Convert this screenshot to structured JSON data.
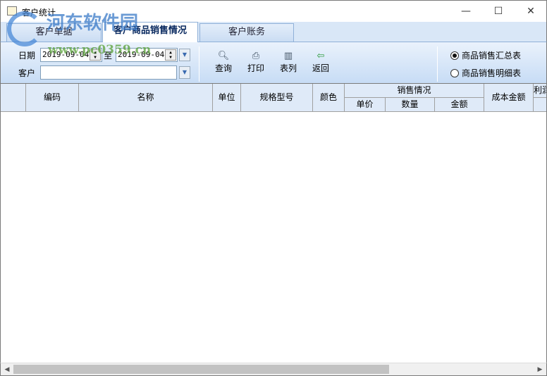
{
  "window": {
    "title": "客户统计",
    "minimize": "—",
    "maximize": "☐",
    "close": "✕"
  },
  "tabs": [
    {
      "label": "客户单据"
    },
    {
      "label": "客户商品销售情况"
    },
    {
      "label": "客户账务"
    }
  ],
  "filters": {
    "date_label": "日期",
    "date_from": "2019-09-04",
    "to_label": "至",
    "date_to": "2019-09-04",
    "customer_label": "客户",
    "customer_value": ""
  },
  "toolbar": [
    {
      "label": "查询",
      "icon": "search-icon"
    },
    {
      "label": "打印",
      "icon": "printer-icon"
    },
    {
      "label": "表列",
      "icon": "columns-icon"
    },
    {
      "label": "返回",
      "icon": "exit-icon"
    }
  ],
  "report_type": {
    "options": [
      {
        "label": "商品销售汇总表",
        "selected": true
      },
      {
        "label": "商品销售明细表",
        "selected": false
      }
    ]
  },
  "table": {
    "headers": {
      "code": "编码",
      "name": "名称",
      "unit": "单位",
      "spec": "规格型号",
      "color": "颜色",
      "sales": "销售情况",
      "price": "单价",
      "qty": "数量",
      "amount": "金额",
      "cost": "成本金额",
      "profit": "利润"
    },
    "rows": []
  },
  "watermark": {
    "text": "河东软件园",
    "url": "www.pc0359.cn"
  }
}
